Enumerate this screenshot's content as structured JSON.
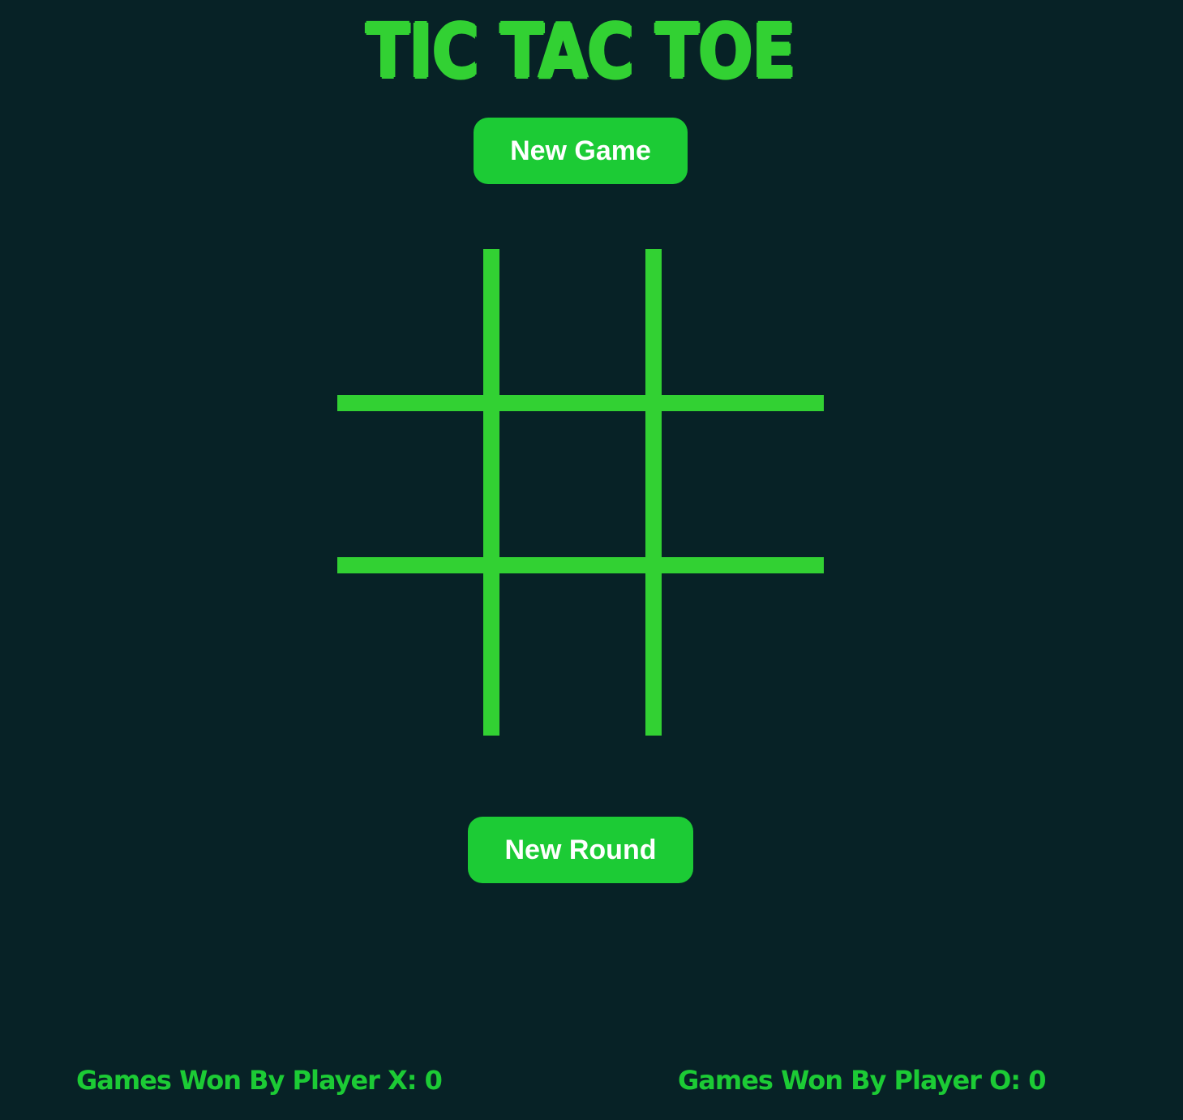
{
  "title": "TIC TAC TOE",
  "buttons": {
    "new_game": "New Game",
    "new_round": "New Round"
  },
  "board": {
    "cells": [
      "",
      "",
      "",
      "",
      "",
      "",
      "",
      "",
      ""
    ]
  },
  "scores": {
    "player_x_label": "Games Won By Player X:",
    "player_x_value": "0",
    "player_o_label": "Games Won By Player O:",
    "player_o_value": "0"
  },
  "colors": {
    "background": "#072226",
    "accent": "#32d133",
    "button": "#1ccb35",
    "button_text": "#ffffff"
  }
}
